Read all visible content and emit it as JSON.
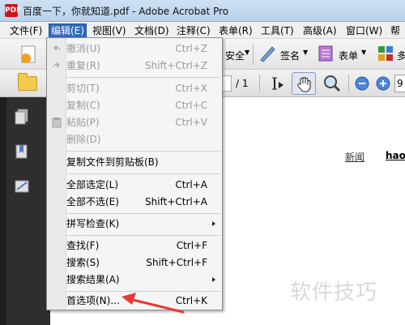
{
  "window": {
    "title": "百度一下，你就知道.pdf - Adobe Acrobat Pro",
    "app_icon_text": "PDF"
  },
  "menubar": {
    "items": [
      {
        "label": "文件(F)"
      },
      {
        "label": "编辑(E)",
        "active": true
      },
      {
        "label": "视图(V)"
      },
      {
        "label": "文档(D)"
      },
      {
        "label": "注释(C)"
      },
      {
        "label": "表单(R)"
      },
      {
        "label": "工具(T)"
      },
      {
        "label": "高级(A)"
      },
      {
        "label": "窗口(W)"
      },
      {
        "label": "帮"
      }
    ]
  },
  "toolbar1": {
    "security_label": "安全",
    "sign_label": "签名",
    "forms_label": "表单",
    "more_label": "多"
  },
  "toolbar2": {
    "page_total": "/ 1",
    "zoom_value": "9"
  },
  "document": {
    "link1": "新闻",
    "link2": "hao"
  },
  "edit_menu": {
    "items": [
      {
        "label": "撤消(U)",
        "shortcut": "Ctrl+Z",
        "disabled": true
      },
      {
        "label": "重复(R)",
        "shortcut": "Shift+Ctrl+Z",
        "disabled": true
      },
      {
        "label": "剪切(T)",
        "shortcut": "Ctrl+X",
        "disabled": true
      },
      {
        "label": "复制(C)",
        "shortcut": "Ctrl+C",
        "disabled": true
      },
      {
        "label": "粘贴(P)",
        "shortcut": "Ctrl+V",
        "disabled": true
      },
      {
        "label": "删除(D)",
        "shortcut": "",
        "disabled": true
      },
      {
        "label": "复制文件到剪贴板(B)",
        "shortcut": ""
      },
      {
        "label": "全部选定(L)",
        "shortcut": "Ctrl+A"
      },
      {
        "label": "全部不选(E)",
        "shortcut": "Shift+Ctrl+A"
      },
      {
        "label": "拼写检查(K)",
        "shortcut": "",
        "submenu": true
      },
      {
        "label": "查找(F)",
        "shortcut": "Ctrl+F"
      },
      {
        "label": "搜索(S)",
        "shortcut": "Shift+Ctrl+F"
      },
      {
        "label": "搜索结果(A)",
        "shortcut": "",
        "submenu": true
      },
      {
        "label": "首选项(N)...",
        "shortcut": "Ctrl+K"
      }
    ]
  },
  "watermark": "软件技巧",
  "colors": {
    "menu_highlight": "#3569b8",
    "annotation_arrow": "#e53935",
    "left_panel": "#2e2e2e"
  }
}
